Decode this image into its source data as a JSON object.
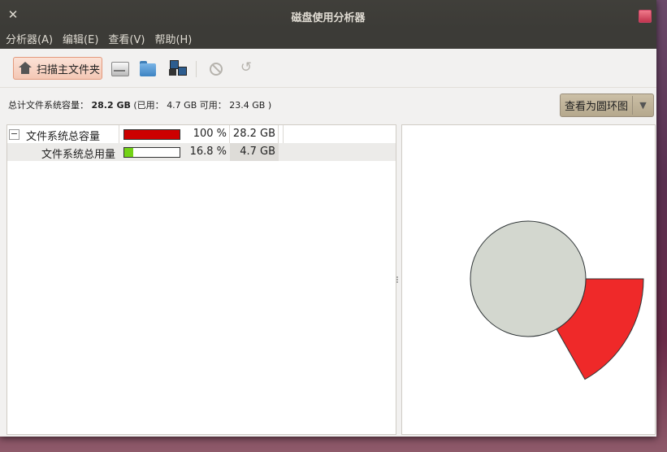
{
  "window": {
    "title": "磁盘使用分析器",
    "close_glyph": "✕"
  },
  "menu": {
    "items": [
      "分析器(A)",
      "编辑(E)",
      "查看(V)",
      "帮助(H)"
    ]
  },
  "toolbar": {
    "scan_home_label": "扫描主文件夹",
    "icons": [
      "home-icon",
      "disk-icon",
      "folder-icon",
      "remote-icon",
      "stop-icon",
      "refresh-icon"
    ],
    "refresh_glyph": "↺"
  },
  "summary": {
    "prefix": "总计文件系统容量：",
    "total": "28.2 GB",
    "used_label": "(已用：",
    "used": "4.7 GB",
    "avail_label": "可用：",
    "avail": "23.4 GB",
    "suffix": ")"
  },
  "view_button": {
    "label": "查看为圆环图",
    "arrow": "▼"
  },
  "tree": {
    "rows": [
      {
        "expander": "−",
        "name": "文件系统总容量",
        "fill": 1.0,
        "percent": "100 %",
        "size": "28.2 GB"
      },
      {
        "name": "文件系统总用量",
        "fill": 0.168,
        "percent": "16.8 %",
        "size": "4.7 GB"
      }
    ]
  },
  "colors": {
    "total_bar": "#cc0000",
    "used_bar": "#73d216",
    "ring_center": "#d3d7cf",
    "ring_used": "#ef2929"
  },
  "chart_data": {
    "type": "pie",
    "segments": [
      {
        "label": "文件系统总用量",
        "value": 16.8
      }
    ],
    "total_percent": 100
  }
}
